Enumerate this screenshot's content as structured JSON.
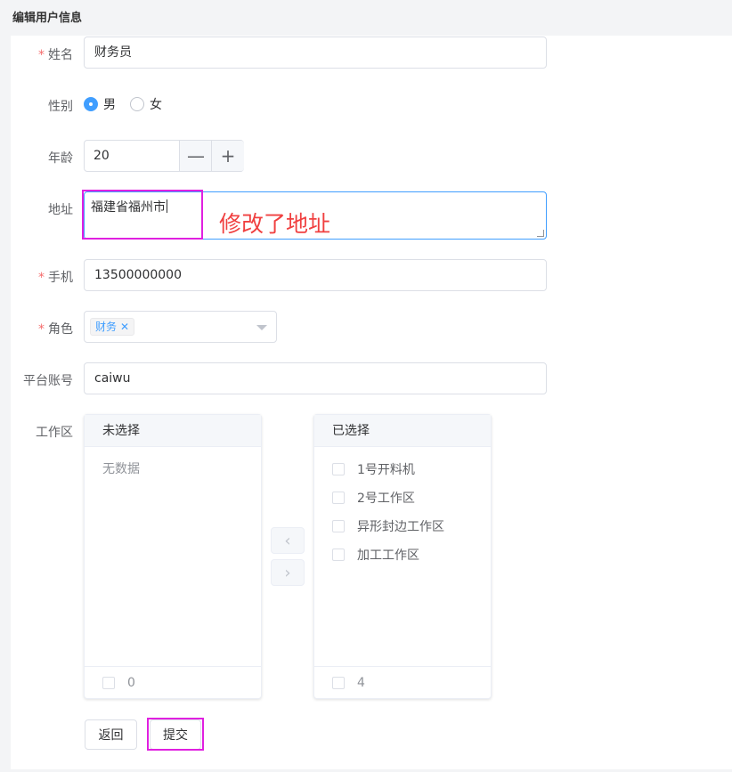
{
  "page": {
    "title": "编辑用户信息"
  },
  "form": {
    "name": {
      "label": "姓名",
      "required_mark": "*",
      "value": "财务员"
    },
    "gender": {
      "label": "性别",
      "options": [
        "男",
        "女"
      ],
      "selected": "男"
    },
    "age": {
      "label": "年龄",
      "value": "20",
      "decrement": "—",
      "increment": "+"
    },
    "address": {
      "label": "地址",
      "value": "福建省福州市"
    },
    "phone": {
      "label": "手机",
      "required_mark": "*",
      "value": "13500000000"
    },
    "role": {
      "label": "角色",
      "required_mark": "*",
      "tags": [
        "财务"
      ],
      "tag_close": "✕"
    },
    "account": {
      "label": "平台账号",
      "value": "caiwu"
    },
    "work_area": {
      "label": "工作区",
      "left_panel": {
        "title": "未选择",
        "empty_text": "无数据",
        "count": "0"
      },
      "right_panel": {
        "title": "已选择",
        "items": [
          "1号开料机",
          "2号工作区",
          "异形封边工作区",
          "加工工作区"
        ],
        "count": "4"
      },
      "to_left": "‹",
      "to_right": "›"
    }
  },
  "annotation": {
    "text": "修改了地址",
    "color": "#f04040",
    "box_color": "#e020e0"
  },
  "buttons": {
    "back": "返回",
    "submit": "提交"
  },
  "colors": {
    "primary": "#409eff",
    "required": "#f56c6c"
  }
}
